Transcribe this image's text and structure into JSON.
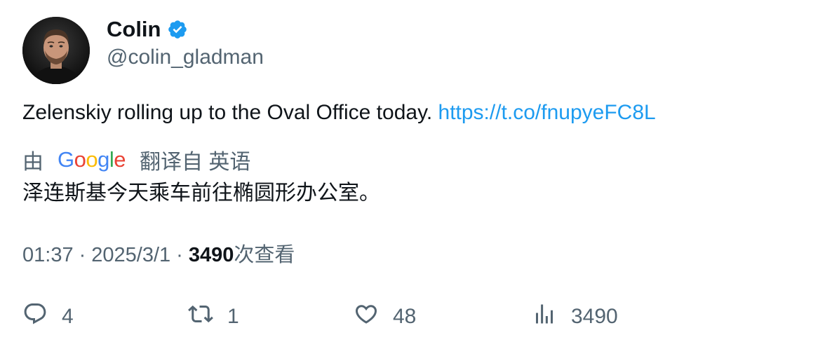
{
  "author": {
    "name": "Colin",
    "handle": "@colin_gladman",
    "verified_color": "#1d9bf0"
  },
  "tweet": {
    "text": "Zelenskiy rolling up to the Oval Office today. ",
    "link": "https://t.co/fnupyeFC8L"
  },
  "translation": {
    "prefix": "由",
    "provider_letters": [
      "G",
      "o",
      "o",
      "g",
      "l",
      "e"
    ],
    "label": "翻译自 英语",
    "text": "泽连斯基今天乘车前往椭圆形办公室。"
  },
  "meta": {
    "time": "01:37",
    "separator": "·",
    "date": "2025/3/1",
    "views": "3490",
    "views_label": "次查看"
  },
  "actions": {
    "replies": "4",
    "retweets": "1",
    "likes": "48",
    "views": "3490"
  },
  "colors": {
    "text": "#0f1419",
    "secondary": "#536471",
    "link": "#1d9bf0"
  }
}
